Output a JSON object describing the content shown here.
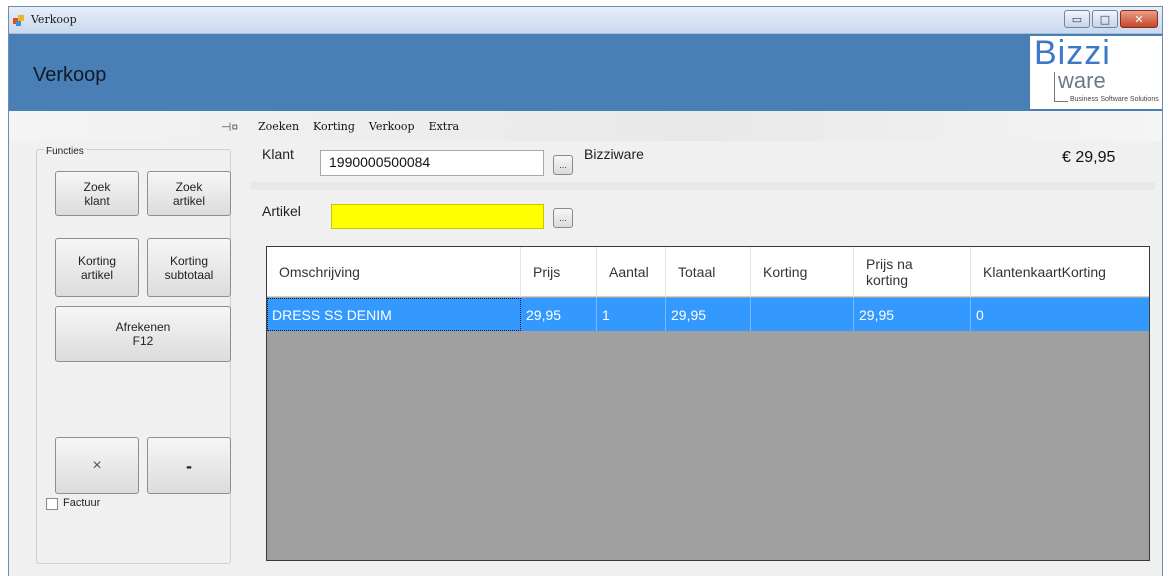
{
  "window": {
    "title": "Verkoop",
    "minimize_icon": "minimize-icon",
    "maximize_icon": "maximize-icon",
    "close_icon": "close-icon"
  },
  "header": {
    "title": "Verkoop",
    "logo": {
      "brand": "Bizzi",
      "sub": "ware",
      "tagline": "Business Software Solutions"
    }
  },
  "toolbar": {
    "pin_icon": "pin-icon",
    "menu": [
      "Zoeken",
      "Korting",
      "Verkoop",
      "Extra"
    ]
  },
  "functions": {
    "group_label": "Functies",
    "buttons": {
      "zoek_klant": "Zoek\nklant",
      "zoek_artikel": "Zoek\nartikel",
      "korting_artikel": "Korting\nartikel",
      "korting_subtotaal": "Korting\nsubtotaal",
      "afrekenen": "Afrekenen\nF12",
      "cancel": "×",
      "minus": "-"
    },
    "factuur_label": "Factuur",
    "factuur_checked": false
  },
  "customer": {
    "label": "Klant",
    "value": "1990000500084",
    "lookup_label": "...",
    "name": "Bizziware"
  },
  "total": "€ 29,95",
  "article": {
    "label": "Artikel",
    "value": "",
    "lookup_label": "..."
  },
  "grid": {
    "columns": [
      "Omschrijving",
      "Prijs",
      "Aantal",
      "Totaal",
      "Korting",
      "Prijs na\nkorting",
      "KlantenkaartKorting"
    ],
    "rows": [
      [
        "DRESS SS DENIM",
        "29,95",
        "1",
        "29,95",
        "",
        "29,95",
        "0"
      ]
    ],
    "colors": {
      "selected_row": "#3399ff",
      "empty_area": "#a0a0a0"
    }
  },
  "colors": {
    "header_band": "#4a7fb5",
    "article_input": "#ffff00"
  }
}
